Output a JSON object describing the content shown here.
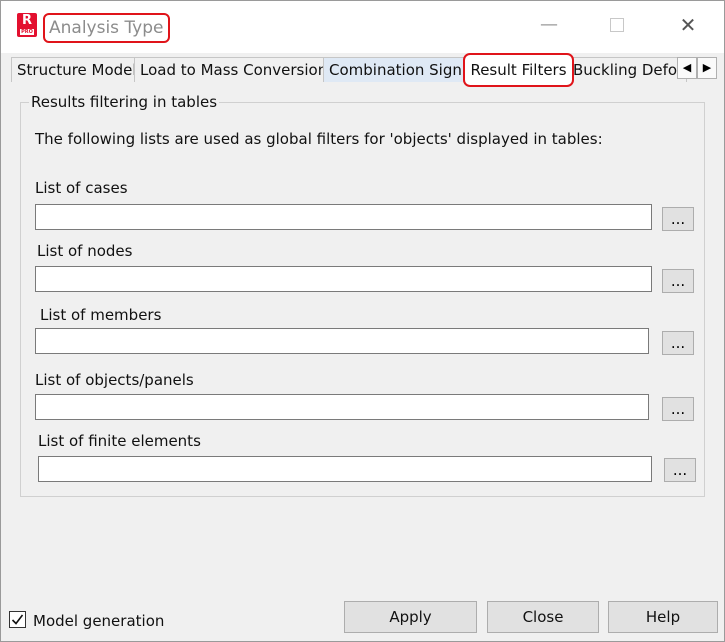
{
  "window": {
    "title": "Analysis Type",
    "app_icon_letter": "R",
    "app_icon_badge": "PRO",
    "minimize_glyph": "—",
    "close_glyph": "✕",
    "accent_color": "#e0141a"
  },
  "tabs": [
    {
      "label": "Structure Model",
      "selected": false
    },
    {
      "label": "Load to Mass Conversion",
      "selected": false
    },
    {
      "label": "Combination Sign",
      "selected": false
    },
    {
      "label": "Result Filters",
      "selected": true
    },
    {
      "label": "Buckling Defor",
      "selected": false
    }
  ],
  "tab_nav": {
    "prev": "◀",
    "next": "▶"
  },
  "group": {
    "title": "Results filtering in tables",
    "intro": "The following lists are used as global filters for 'objects' displayed in tables:"
  },
  "fields": [
    {
      "label": "List of cases",
      "value": "",
      "browse": "..."
    },
    {
      "label": "List of nodes",
      "value": "",
      "browse": "..."
    },
    {
      "label": "List of members",
      "value": "",
      "browse": "..."
    },
    {
      "label": "List of objects/panels",
      "value": "",
      "browse": "..."
    },
    {
      "label": "List of finite elements",
      "value": "",
      "browse": "..."
    }
  ],
  "footer": {
    "model_generation_label": "Model generation",
    "model_generation_checked": true,
    "apply": "Apply",
    "close": "Close",
    "help": "Help"
  }
}
